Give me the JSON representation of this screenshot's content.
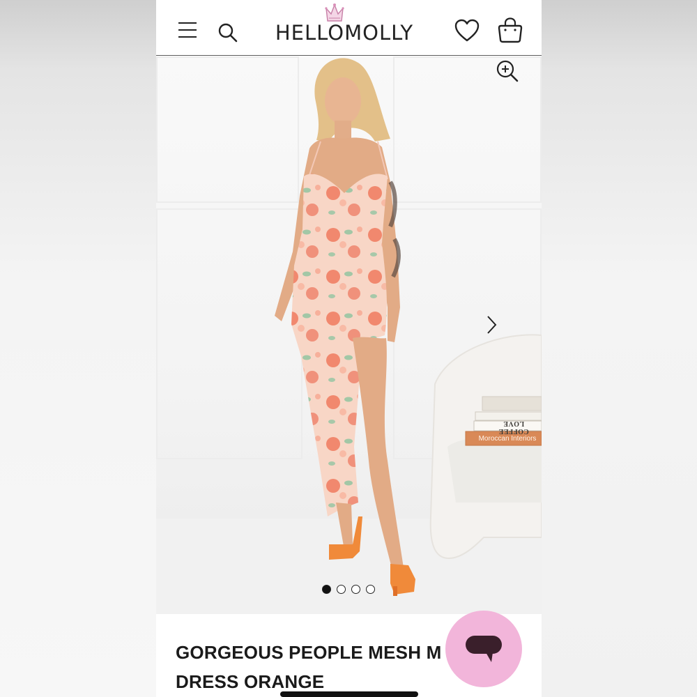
{
  "header": {
    "brand": "HELLOMOLLY",
    "menu_icon": "hamburger-menu-icon",
    "search_icon": "search-icon",
    "wishlist_icon": "heart-icon",
    "bag_icon": "shopping-bag-icon"
  },
  "gallery": {
    "zoom_icon": "zoom-in-icon",
    "next_icon": "chevron-right-icon",
    "image_count": 4,
    "active_index": 0,
    "books": [
      "COFFEE LOVE",
      "Moroccan Interiors"
    ]
  },
  "product": {
    "title_line1": "GORGEOUS PEOPLE MESH M",
    "title_line2": "DRESS ORANGE"
  },
  "chat": {
    "icon": "chat-bubble-icon"
  },
  "colors": {
    "chat_button": "#f2b5da",
    "text": "#1a1a1a",
    "crown": "#d98fb8",
    "dress_pink": "#f7c9b8",
    "rose": "#f07a5e",
    "heel_orange": "#f08a3a"
  }
}
